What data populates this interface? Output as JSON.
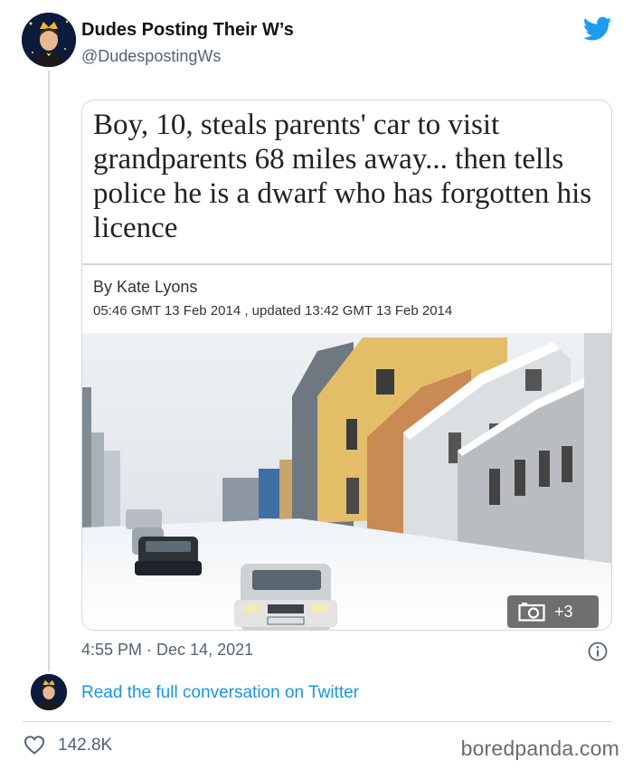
{
  "tweet": {
    "author": {
      "display_name": "Dudes Posting Their W’s",
      "handle": "@DudespostingWs"
    },
    "article": {
      "headline": "Boy, 10, steals parents' car to visit grandparents 68 miles away... then tells police he is a dwarf who has forgotten his licence",
      "byline": "By Kate Lyons",
      "dateline": "05:46 GMT 13 Feb 2014 , updated 13:42 GMT 13 Feb 2014",
      "photo_alt_icon": "snowy-street-photo"
    },
    "media_badge": "+3",
    "timestamp": "4:55 PM · Dec 14, 2021",
    "read_more": "Read the full conversation on Twitter",
    "likes": "142.8K"
  },
  "watermark": "boredpanda.com",
  "colors": {
    "link": "#1b95e0",
    "twitter_blue": "#1d9bf0",
    "muted": "#536471",
    "border": "#cfd9de"
  },
  "icons": [
    "twitter-bird-icon",
    "camera-icon",
    "info-icon",
    "heart-icon",
    "avatar-crown-icon"
  ]
}
